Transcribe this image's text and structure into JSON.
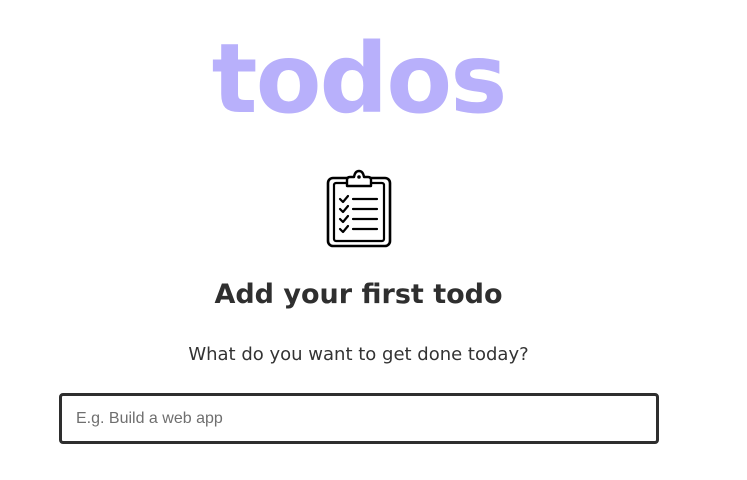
{
  "header": {
    "title": "todos",
    "title_color": "#b8b0fb"
  },
  "empty_state": {
    "icon": "clipboard-checklist-icon",
    "heading": "Add your first todo",
    "subtext": "What do you want to get done today?"
  },
  "new_todo_input": {
    "value": "",
    "placeholder": "E.g. Build a web app"
  }
}
